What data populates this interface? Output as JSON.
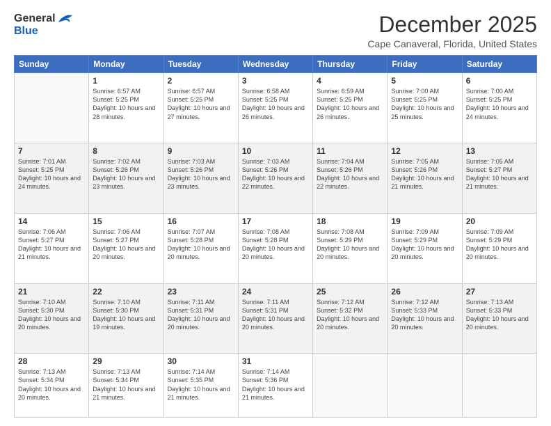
{
  "logo": {
    "general": "General",
    "blue": "Blue"
  },
  "header": {
    "title": "December 2025",
    "location": "Cape Canaveral, Florida, United States"
  },
  "weekdays": [
    "Sunday",
    "Monday",
    "Tuesday",
    "Wednesday",
    "Thursday",
    "Friday",
    "Saturday"
  ],
  "weeks": [
    [
      {
        "num": "",
        "empty": true
      },
      {
        "num": "1",
        "sunrise": "6:57 AM",
        "sunset": "5:25 PM",
        "daylight": "10 hours and 28 minutes."
      },
      {
        "num": "2",
        "sunrise": "6:57 AM",
        "sunset": "5:25 PM",
        "daylight": "10 hours and 27 minutes."
      },
      {
        "num": "3",
        "sunrise": "6:58 AM",
        "sunset": "5:25 PM",
        "daylight": "10 hours and 26 minutes."
      },
      {
        "num": "4",
        "sunrise": "6:59 AM",
        "sunset": "5:25 PM",
        "daylight": "10 hours and 26 minutes."
      },
      {
        "num": "5",
        "sunrise": "7:00 AM",
        "sunset": "5:25 PM",
        "daylight": "10 hours and 25 minutes."
      },
      {
        "num": "6",
        "sunrise": "7:00 AM",
        "sunset": "5:25 PM",
        "daylight": "10 hours and 24 minutes."
      }
    ],
    [
      {
        "num": "7",
        "sunrise": "7:01 AM",
        "sunset": "5:25 PM",
        "daylight": "10 hours and 24 minutes."
      },
      {
        "num": "8",
        "sunrise": "7:02 AM",
        "sunset": "5:26 PM",
        "daylight": "10 hours and 23 minutes."
      },
      {
        "num": "9",
        "sunrise": "7:03 AM",
        "sunset": "5:26 PM",
        "daylight": "10 hours and 23 minutes."
      },
      {
        "num": "10",
        "sunrise": "7:03 AM",
        "sunset": "5:26 PM",
        "daylight": "10 hours and 22 minutes."
      },
      {
        "num": "11",
        "sunrise": "7:04 AM",
        "sunset": "5:26 PM",
        "daylight": "10 hours and 22 minutes."
      },
      {
        "num": "12",
        "sunrise": "7:05 AM",
        "sunset": "5:26 PM",
        "daylight": "10 hours and 21 minutes."
      },
      {
        "num": "13",
        "sunrise": "7:05 AM",
        "sunset": "5:27 PM",
        "daylight": "10 hours and 21 minutes."
      }
    ],
    [
      {
        "num": "14",
        "sunrise": "7:06 AM",
        "sunset": "5:27 PM",
        "daylight": "10 hours and 21 minutes."
      },
      {
        "num": "15",
        "sunrise": "7:06 AM",
        "sunset": "5:27 PM",
        "daylight": "10 hours and 20 minutes."
      },
      {
        "num": "16",
        "sunrise": "7:07 AM",
        "sunset": "5:28 PM",
        "daylight": "10 hours and 20 minutes."
      },
      {
        "num": "17",
        "sunrise": "7:08 AM",
        "sunset": "5:28 PM",
        "daylight": "10 hours and 20 minutes."
      },
      {
        "num": "18",
        "sunrise": "7:08 AM",
        "sunset": "5:29 PM",
        "daylight": "10 hours and 20 minutes."
      },
      {
        "num": "19",
        "sunrise": "7:09 AM",
        "sunset": "5:29 PM",
        "daylight": "10 hours and 20 minutes."
      },
      {
        "num": "20",
        "sunrise": "7:09 AM",
        "sunset": "5:29 PM",
        "daylight": "10 hours and 20 minutes."
      }
    ],
    [
      {
        "num": "21",
        "sunrise": "7:10 AM",
        "sunset": "5:30 PM",
        "daylight": "10 hours and 20 minutes."
      },
      {
        "num": "22",
        "sunrise": "7:10 AM",
        "sunset": "5:30 PM",
        "daylight": "10 hours and 19 minutes."
      },
      {
        "num": "23",
        "sunrise": "7:11 AM",
        "sunset": "5:31 PM",
        "daylight": "10 hours and 20 minutes."
      },
      {
        "num": "24",
        "sunrise": "7:11 AM",
        "sunset": "5:31 PM",
        "daylight": "10 hours and 20 minutes."
      },
      {
        "num": "25",
        "sunrise": "7:12 AM",
        "sunset": "5:32 PM",
        "daylight": "10 hours and 20 minutes."
      },
      {
        "num": "26",
        "sunrise": "7:12 AM",
        "sunset": "5:33 PM",
        "daylight": "10 hours and 20 minutes."
      },
      {
        "num": "27",
        "sunrise": "7:13 AM",
        "sunset": "5:33 PM",
        "daylight": "10 hours and 20 minutes."
      }
    ],
    [
      {
        "num": "28",
        "sunrise": "7:13 AM",
        "sunset": "5:34 PM",
        "daylight": "10 hours and 20 minutes."
      },
      {
        "num": "29",
        "sunrise": "7:13 AM",
        "sunset": "5:34 PM",
        "daylight": "10 hours and 21 minutes."
      },
      {
        "num": "30",
        "sunrise": "7:14 AM",
        "sunset": "5:35 PM",
        "daylight": "10 hours and 21 minutes."
      },
      {
        "num": "31",
        "sunrise": "7:14 AM",
        "sunset": "5:36 PM",
        "daylight": "10 hours and 21 minutes."
      },
      {
        "num": "",
        "empty": true
      },
      {
        "num": "",
        "empty": true
      },
      {
        "num": "",
        "empty": true
      }
    ]
  ],
  "labels": {
    "sunrise_prefix": "Sunrise: ",
    "sunset_prefix": "Sunset: ",
    "daylight_prefix": "Daylight: "
  }
}
